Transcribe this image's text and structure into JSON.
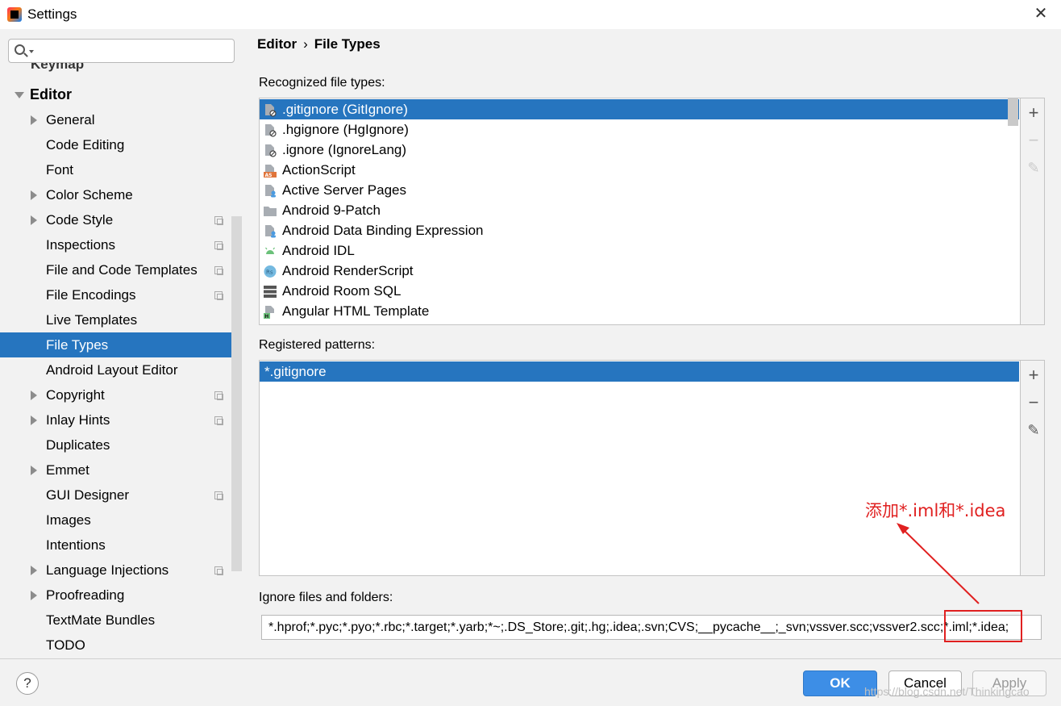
{
  "window": {
    "title": "Settings",
    "close_glyph": "✕"
  },
  "search": {
    "value": "",
    "placeholder": ""
  },
  "sidebar": {
    "cut_item": "Keymap",
    "items": [
      {
        "label": "Editor",
        "root": true,
        "expandable": true,
        "expanded": true,
        "project": false
      },
      {
        "label": "General",
        "expandable": true,
        "project": false
      },
      {
        "label": "Code Editing",
        "expandable": false,
        "project": false
      },
      {
        "label": "Font",
        "expandable": false,
        "project": false
      },
      {
        "label": "Color Scheme",
        "expandable": true,
        "project": false
      },
      {
        "label": "Code Style",
        "expandable": true,
        "project": true
      },
      {
        "label": "Inspections",
        "expandable": false,
        "project": true
      },
      {
        "label": "File and Code Templates",
        "expandable": false,
        "project": true
      },
      {
        "label": "File Encodings",
        "expandable": false,
        "project": true
      },
      {
        "label": "Live Templates",
        "expandable": false,
        "project": false
      },
      {
        "label": "File Types",
        "expandable": false,
        "project": false,
        "selected": true
      },
      {
        "label": "Android Layout Editor",
        "expandable": false,
        "project": false
      },
      {
        "label": "Copyright",
        "expandable": true,
        "project": true
      },
      {
        "label": "Inlay Hints",
        "expandable": true,
        "project": true
      },
      {
        "label": "Duplicates",
        "expandable": false,
        "project": false
      },
      {
        "label": "Emmet",
        "expandable": true,
        "project": false
      },
      {
        "label": "GUI Designer",
        "expandable": false,
        "project": true
      },
      {
        "label": "Images",
        "expandable": false,
        "project": false
      },
      {
        "label": "Intentions",
        "expandable": false,
        "project": false
      },
      {
        "label": "Language Injections",
        "expandable": true,
        "project": true
      },
      {
        "label": "Proofreading",
        "expandable": true,
        "project": false
      },
      {
        "label": "TextMate Bundles",
        "expandable": false,
        "project": false
      },
      {
        "label": "TODO",
        "expandable": false,
        "project": false
      }
    ]
  },
  "breadcrumb": {
    "parent": "Editor",
    "separator": "›",
    "current": "File Types"
  },
  "recognized": {
    "label": "Recognized file types:",
    "items": [
      {
        "name": ".gitignore (GitIgnore)",
        "icon": "ignore-file-icon",
        "selected": true
      },
      {
        "name": ".hgignore (HgIgnore)",
        "icon": "ignore-file-icon"
      },
      {
        "name": ".ignore (IgnoreLang)",
        "icon": "ignore-file-icon"
      },
      {
        "name": "ActionScript",
        "icon": "actionscript-icon"
      },
      {
        "name": "Active Server Pages",
        "icon": "asp-file-icon"
      },
      {
        "name": "Android 9-Patch",
        "icon": "folder-icon"
      },
      {
        "name": "Android Data Binding Expression",
        "icon": "asp-file-icon"
      },
      {
        "name": "Android IDL",
        "icon": "android-icon"
      },
      {
        "name": "Android RenderScript",
        "icon": "renderscript-icon"
      },
      {
        "name": "Android Room SQL",
        "icon": "database-icon"
      },
      {
        "name": "Angular HTML Template",
        "icon": "html-file-icon"
      }
    ],
    "add": "+",
    "remove": "−",
    "edit": "✎"
  },
  "patterns": {
    "label": "Registered patterns:",
    "items": [
      "*.gitignore"
    ],
    "add": "+",
    "remove": "−",
    "edit": "✎"
  },
  "ignore": {
    "label": "Ignore files and folders:",
    "value": "*.hprof;*.pyc;*.pyo;*.rbc;*.target;*.yarb;*~;.DS_Store;.git;.hg;.idea;.svn;CVS;__pycache__;_svn;vssver.scc;vssver2.scc;*.iml;*.idea;"
  },
  "annotation": {
    "text": "添加*.iml和*.idea",
    "color": "#e02020"
  },
  "buttons": {
    "help": "?",
    "ok": "OK",
    "cancel": "Cancel",
    "apply": "Apply"
  },
  "watermark": "https://blog.csdn.net/Thinkingcao",
  "colors": {
    "selection": "#2675bf",
    "ok_button": "#3d8ee6",
    "annotation": "#e02020"
  }
}
